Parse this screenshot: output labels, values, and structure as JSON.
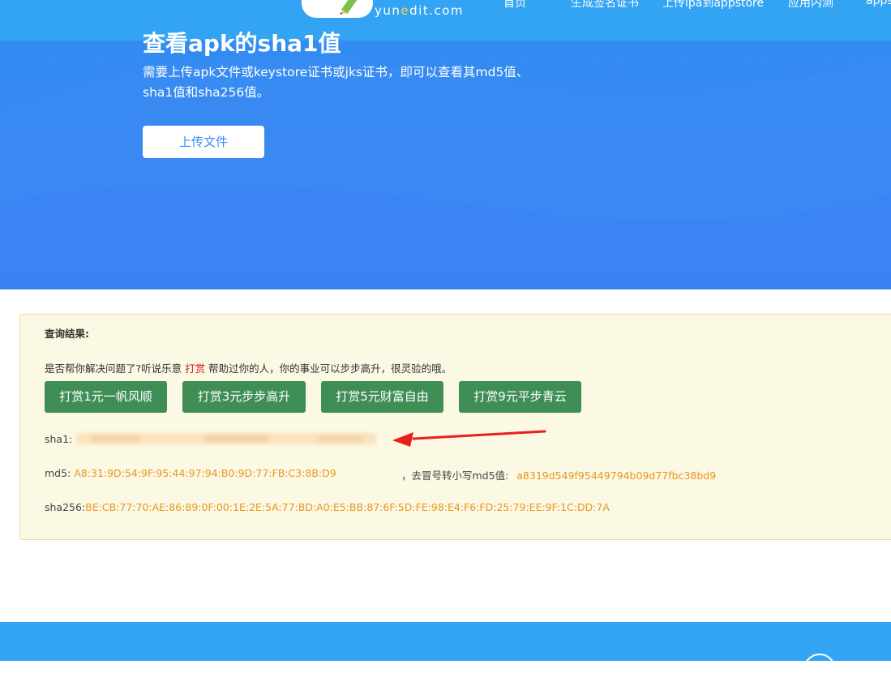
{
  "header": {
    "logo_text_pre": "yun",
    "logo_text_e": "e",
    "logo_text_post": "dit.com",
    "nav": [
      "首页",
      "生成签名证书",
      "上传ipa到appstore",
      "应用内测",
      "apps"
    ]
  },
  "hero": {
    "title": "查看apk的sha1值",
    "description": "需要上传apk文件或keystore证书或jks证书，即可以查看其md5值、sha1值和sha256值。",
    "upload_label": "上传文件"
  },
  "result": {
    "title": "查询结果:",
    "tip_pre": "是否帮你解决问题了?听说乐意 ",
    "tip_reward": "打赏",
    "tip_post": " 帮助过你的人，你的事业可以步步高升，很灵验的哦。",
    "reward_buttons": [
      "打赏1元一帆风顺",
      "打赏3元步步高升",
      "打赏5元财富自由",
      "打赏9元平步青云"
    ],
    "sha1_label": "sha1:",
    "md5_label": "md5:",
    "md5_value": "A8:31:9D:54:9F:95:44:97:94:B0:9D:77:FB:C3:8B:D9",
    "md5_lower_label": "，去冒号转小写md5值:",
    "md5_lower_value": "a8319d549f95449794b09d77fbc38bd9",
    "sha256_label": "sha256:",
    "sha256_value": "BE:CB:77:70:AE:86:89:0F:00:1E:2E:5A:77:BD:A0:E5:BB:87:6F:5D:FE:98:E4:F6:FD:25:79:EE:9F:1C:DD:7A"
  },
  "colors": {
    "hero_blue": "#3a86f2",
    "nav_blue": "#33a4f3",
    "reward_green": "#3e8e56",
    "value_orange": "#e89620",
    "panel_bg": "#fbf8e3",
    "arrow_red": "#e8201c"
  },
  "icons": [
    "pencil-icon",
    "arrow-annotation"
  ]
}
